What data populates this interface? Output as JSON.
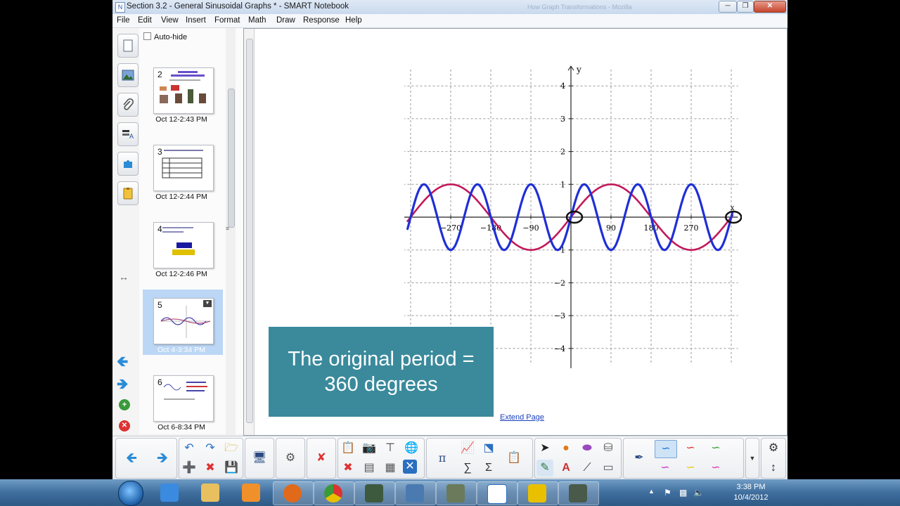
{
  "window": {
    "title": "Section 3.2 - General Sinusoidal Graphs * - SMART Notebook",
    "background_title": "How Graph Transformations - Mozilla",
    "app_icon": "notebook-icon"
  },
  "menu": [
    "File",
    "Edit",
    "View",
    "Insert",
    "Format",
    "Math",
    "Draw",
    "Response",
    "Help"
  ],
  "sorter": {
    "autohide_label": "Auto-hide",
    "pages": [
      {
        "num": "2",
        "caption": "Oct 12-2:43 PM"
      },
      {
        "num": "3",
        "caption": "Oct 12-2:44 PM"
      },
      {
        "num": "4",
        "caption": "Oct 12-2:46 PM"
      },
      {
        "num": "5",
        "caption": "Oct 4-3:34 PM",
        "selected": true
      },
      {
        "num": "6",
        "caption": "Oct 6-8:34 PM"
      }
    ]
  },
  "graph": {
    "y_axis_label": "y",
    "x_axis_label": "x",
    "x_ticks": [
      "−270",
      "−180",
      "−90",
      "90",
      "180",
      "270"
    ],
    "y_ticks": [
      "4",
      "3",
      "2",
      "1",
      "−1",
      "−2",
      "−3",
      "−4"
    ],
    "x_range": [
      -405,
      405
    ],
    "y_range": [
      -4.5,
      4.5
    ],
    "curves": [
      {
        "function": "sin(x)",
        "color": "#c2185b"
      },
      {
        "function": "sin(3x)",
        "color": "#1f2fd6"
      }
    ],
    "marked_points": [
      "0",
      "405"
    ]
  },
  "textbox": {
    "line1": "The original period =",
    "line2": "360 degrees",
    "color": "#3a8a9c"
  },
  "extend_page": "Extend Page",
  "taskbar": {
    "time": "3:38 PM",
    "date": "10/4/2012"
  }
}
